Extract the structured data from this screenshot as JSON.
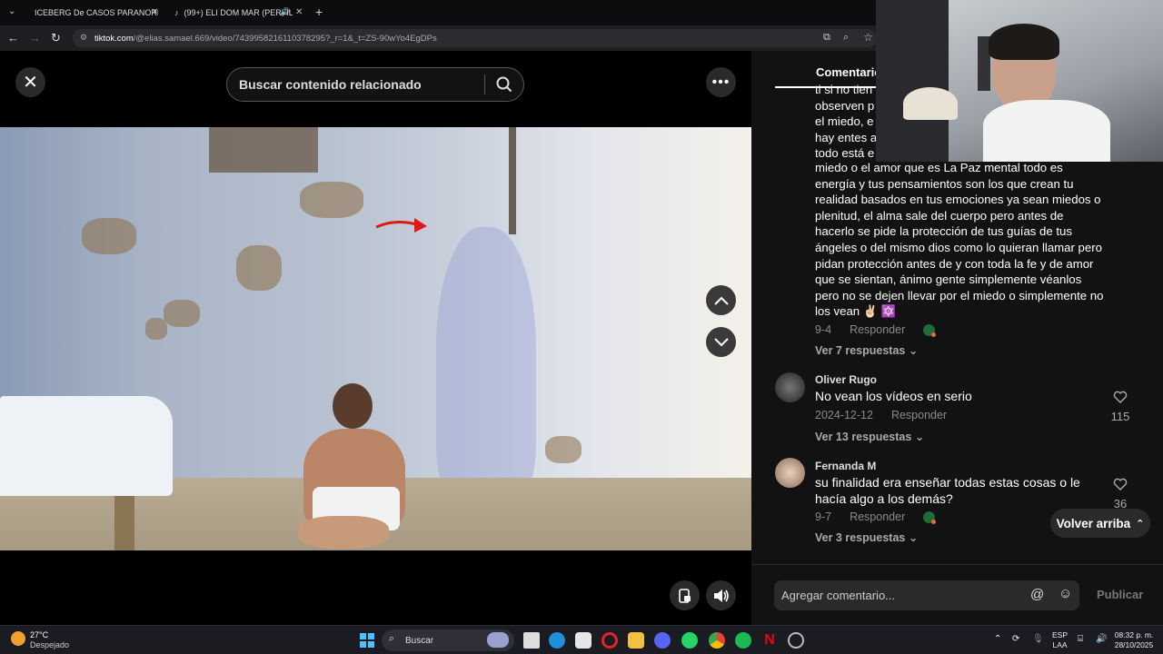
{
  "browser": {
    "tabs": [
      {
        "label": "ICEBERG De CASOS PARANORM",
        "color": "#ff0000"
      },
      {
        "label": "(99+) ELI DOM MAR (PERFIL",
        "color": "#ffffff"
      }
    ],
    "url_host": "tiktok.com",
    "url_path": "/@elias.samael.669/video/7439958216110378295?_r=1&_t=ZS-90wYo4EgDPs"
  },
  "video": {
    "search_placeholder": "Buscar contenido relacionado"
  },
  "comments": {
    "tab_label": "Comentarios",
    "partial_lines": [
      "ti si no tien",
      "observen p",
      "el miedo, e",
      "hay entes a",
      "todo está e"
    ],
    "comment1_text": "miedo o el amor que es La Paz mental todo es energía y tus pensamientos son los que crean tu realidad basados en tus emociones ya sean miedos o plenitud, el alma sale del cuerpo pero antes de hacerlo se pide la protección de tus guías de tus ángeles o del mismo dios como lo quieran llamar pero pidan protección antes de y con toda la fe y de amor que se sientan, ánimo gente simplemente véanlos pero no se dejen llevar por el miedo o simplemente no los vean ✌🏻 🔯",
    "comment1_date": "9-4",
    "comment1_reply": "Responder",
    "comment1_replies": "Ver 7 respuestas",
    "comment2_name": "Oliver Rugo",
    "comment2_text": "No vean los vídeos en serio",
    "comment2_date": "2024-12-12",
    "comment2_reply": "Responder",
    "comment2_replies": "Ver 13 respuestas",
    "comment2_likes": "115",
    "comment3_name": "Fernanda M",
    "comment3_text": "su finalidad era enseñar todas estas cosas o le hacía algo a los demás?",
    "comment3_date": "9-7",
    "comment3_reply": "Responder",
    "comment3_replies": "Ver 3 respuestas",
    "comment3_likes": "36",
    "back_to_top": "Volver arriba",
    "add_comment_placeholder": "Agregar comentario...",
    "publish_label": "Publicar"
  },
  "taskbar": {
    "weather_temp": "27°C",
    "weather_desc": "Despejado",
    "search_label": "Buscar",
    "lang_1": "ESP",
    "lang_2": "LAA",
    "time": "08:32 p. m.",
    "date": "28/10/2025"
  }
}
